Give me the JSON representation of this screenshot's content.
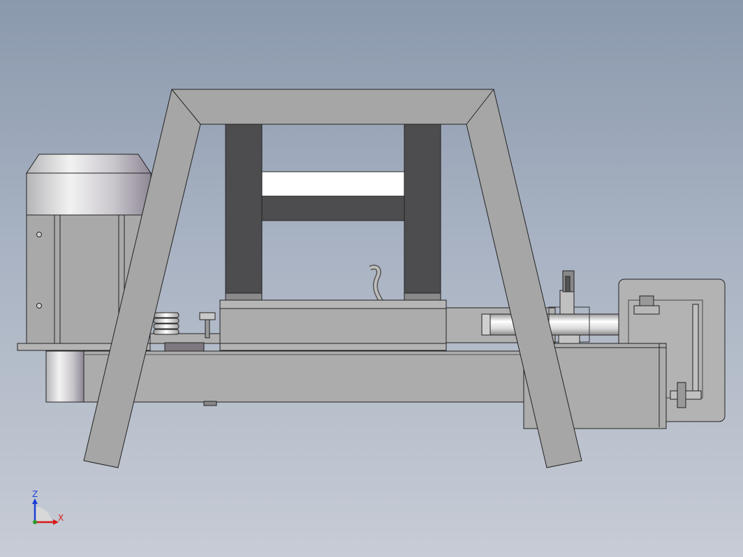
{
  "viewport": {
    "background_top": "#8b99ad",
    "background_bottom": "#c7ccd5"
  },
  "model": {
    "frame_color": "#a6a6a6",
    "column_color": "#4d4d50",
    "edge_color": "#222222"
  },
  "triad": {
    "z_label": "Z",
    "x_label": "X",
    "z_color": "#1a3fd6",
    "x_color": "#d61a1a"
  }
}
